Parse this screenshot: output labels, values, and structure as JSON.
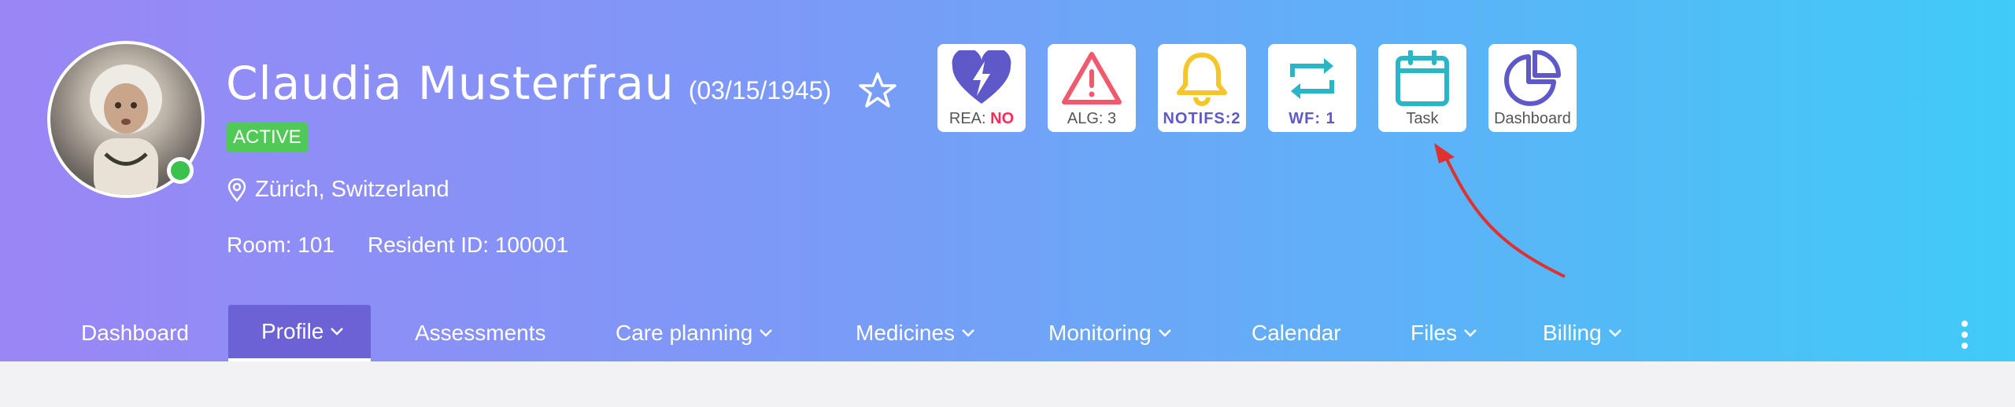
{
  "patient": {
    "name": "Claudia Musterfrau",
    "dob": "(03/15/1945)",
    "status": "ACTIVE",
    "location": "Zürich, Switzerland",
    "room": "Room: 101",
    "resident_id": "Resident ID: 100001"
  },
  "tiles": {
    "rea": {
      "label": "REA: ",
      "value": "NO",
      "color": "#5f58c9"
    },
    "alg": {
      "label": "ALG: 3",
      "color": "#ef5a6e"
    },
    "notifs": {
      "label": "NOTIFS:2",
      "color": "#f5c62b"
    },
    "wf": {
      "label": "WF: 1",
      "color": "#29b6c7"
    },
    "task": {
      "label": "Task",
      "color": "#29b6c7"
    },
    "dashboard": {
      "label": "Dashboard",
      "color": "#5f58c9"
    }
  },
  "nav": {
    "items": [
      {
        "label": "Dashboard"
      },
      {
        "label": "Profile"
      },
      {
        "label": "Assessments"
      },
      {
        "label": "Care planning"
      },
      {
        "label": "Medicines"
      },
      {
        "label": "Monitoring"
      },
      {
        "label": "Calendar"
      },
      {
        "label": "Files"
      },
      {
        "label": "Billing"
      }
    ],
    "active": "Profile"
  },
  "colors": {
    "gradient_start": "#9b86f5",
    "gradient_end": "#40cbf8",
    "active_nav": "#6b62d6",
    "status_green": "#50c956",
    "annotation_arrow": "#e03030"
  }
}
